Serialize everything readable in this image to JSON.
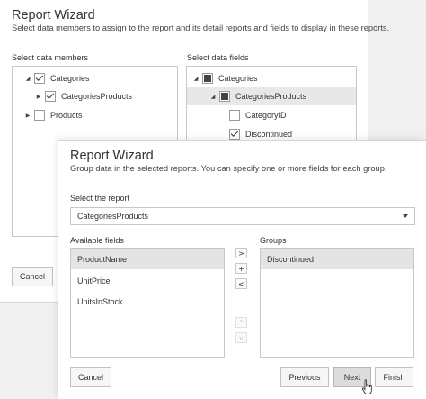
{
  "back_wizard": {
    "title": "Report Wizard",
    "subtitle": "Select data members to assign to the report and its detail reports and fields to display in these reports.",
    "members_label": "Select data members",
    "fields_label": "Select data fields",
    "members_tree": [
      {
        "label": "Categories",
        "state": "checked",
        "expand": "expanded"
      },
      {
        "label": "CategoriesProducts",
        "state": "checked",
        "expand": "collapsed"
      },
      {
        "label": "Products",
        "state": "unchecked",
        "expand": "collapsed"
      }
    ],
    "fields_tree": [
      {
        "label": "Categories",
        "state": "partial",
        "expand": "expanded"
      },
      {
        "label": "CategoriesProducts",
        "state": "partial",
        "expand": "expanded",
        "selected": true
      },
      {
        "label": "CategoryID",
        "state": "unchecked",
        "expand": "none"
      },
      {
        "label": "Discontinued",
        "state": "checked",
        "expand": "none"
      }
    ],
    "cancel_label": "Cancel"
  },
  "front_wizard": {
    "title": "Report Wizard",
    "subtitle": "Group data in the selected reports. You can specify one or more fields for each group.",
    "report_label": "Select the report",
    "report_value": "CategoriesProducts",
    "available_label": "Available fields",
    "groups_label": "Groups",
    "available_fields": [
      "ProductName",
      "UnitPrice",
      "UnitsInStock"
    ],
    "groups": [
      "Discontinued"
    ],
    "move_buttons": {
      "add_to_group": ">",
      "new_group": "+",
      "remove": "<",
      "up": "^",
      "down": "v"
    },
    "buttons": {
      "cancel": "Cancel",
      "previous": "Previous",
      "next": "Next",
      "finish": "Finish"
    }
  },
  "colors": {
    "selection": "#e4e4e4",
    "panel_border": "#c8c8c8",
    "background": "#f0f0f0"
  }
}
